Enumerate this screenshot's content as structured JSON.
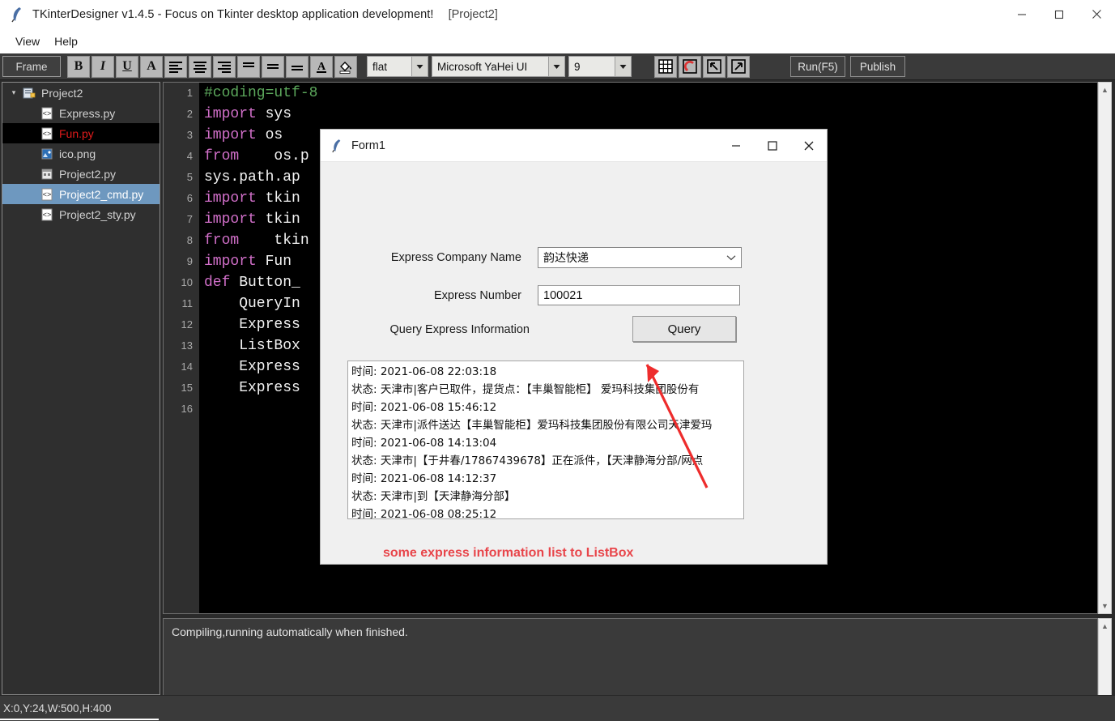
{
  "window": {
    "icon": "feather-icon",
    "title": "TKinterDesigner v1.4.5 - Focus on Tkinter desktop application development!",
    "project": "[Project2]",
    "controls": {
      "minimize": "—",
      "maximize": "□",
      "close": "✕"
    }
  },
  "menu": {
    "items": [
      {
        "label": "View"
      },
      {
        "label": "Help"
      }
    ]
  },
  "toolbar": {
    "widget_label": "Frame",
    "buttons": [
      {
        "name": "bold-button",
        "glyph": "B"
      },
      {
        "name": "italic-button",
        "glyph": "I"
      },
      {
        "name": "underline-button",
        "glyph": "U"
      },
      {
        "name": "font-button",
        "glyph": "A"
      },
      {
        "name": "align-left-button",
        "glyph": "align-left-icon"
      },
      {
        "name": "align-center-button",
        "glyph": "align-center-icon"
      },
      {
        "name": "align-right-button",
        "glyph": "align-right-icon"
      },
      {
        "name": "align-justify-button",
        "glyph": "align-justify-icon"
      },
      {
        "name": "align-top-button",
        "glyph": "align-top-icon"
      },
      {
        "name": "align-middle-button",
        "glyph": "align-middle-icon"
      },
      {
        "name": "text-color-button",
        "glyph": "A"
      },
      {
        "name": "fill-color-button",
        "glyph": "paint-bucket-icon"
      }
    ],
    "relief_value": "flat",
    "font_value": "Microsoft YaHei UI",
    "size_value": "9",
    "right_buttons": [
      {
        "name": "grid-button",
        "glyph": "grid-icon"
      },
      {
        "name": "magnet-button",
        "glyph": "magnet-icon"
      },
      {
        "name": "undo-button",
        "glyph": "undo-icon"
      },
      {
        "name": "redo-button",
        "glyph": "redo-icon"
      }
    ],
    "run_label": "Run(F5)",
    "publish_label": "Publish"
  },
  "tree": {
    "root": {
      "label": "Project2",
      "icon": "project-icon",
      "expanded": true
    },
    "items": [
      {
        "label": "Express.py",
        "icon": "code-file-icon",
        "state": "normal"
      },
      {
        "label": "Fun.py",
        "icon": "code-file-icon",
        "state": "highlight-black"
      },
      {
        "label": "ico.png",
        "icon": "image-file-icon",
        "state": "normal"
      },
      {
        "label": "Project2.py",
        "icon": "form-file-icon",
        "state": "normal"
      },
      {
        "label": "Project2_cmd.py",
        "icon": "code-file-icon",
        "state": "selected"
      },
      {
        "label": "Project2_sty.py",
        "icon": "code-file-icon",
        "state": "normal"
      }
    ]
  },
  "editor": {
    "line_numbers": [
      "1",
      "2",
      "3",
      "4",
      "5",
      "6",
      "7",
      "8",
      "9",
      "10",
      "11",
      "12",
      "13",
      "14",
      "15",
      "16"
    ],
    "lines": [
      {
        "tokens": [
          {
            "t": "#coding=utf-8",
            "c": "cmt"
          }
        ]
      },
      {
        "tokens": [
          {
            "t": "import",
            "c": "kw"
          },
          {
            "t": " sys",
            "c": "id"
          }
        ]
      },
      {
        "tokens": [
          {
            "t": "import",
            "c": "kw"
          },
          {
            "t": " os",
            "c": "id"
          }
        ]
      },
      {
        "tokens": [
          {
            "t": "from",
            "c": "kw"
          },
          {
            "t": "    os.p",
            "c": "id"
          }
        ]
      },
      {
        "tokens": [
          {
            "t": "sys.path.ap",
            "c": "id"
          }
        ]
      },
      {
        "tokens": [
          {
            "t": "import",
            "c": "kw"
          },
          {
            "t": " tkin",
            "c": "id"
          }
        ]
      },
      {
        "tokens": [
          {
            "t": "import",
            "c": "kw"
          },
          {
            "t": " tkin",
            "c": "id"
          }
        ]
      },
      {
        "tokens": [
          {
            "t": "from",
            "c": "kw"
          },
          {
            "t": "    tkin",
            "c": "id"
          }
        ]
      },
      {
        "tokens": [
          {
            "t": "import",
            "c": "kw"
          },
          {
            "t": " Fun",
            "c": "id"
          }
        ]
      },
      {
        "tokens": [
          {
            "t": "def",
            "c": "kw"
          },
          {
            "t": " Button_",
            "c": "id"
          }
        ]
      },
      {
        "tokens": [
          {
            "t": "    QueryIn",
            "c": "id"
          }
        ]
      },
      {
        "tokens": [
          {
            "t": "    Express",
            "c": "id"
          }
        ]
      },
      {
        "tokens": [
          {
            "t": "    ListBox",
            "c": "id"
          }
        ]
      },
      {
        "tokens": [
          {
            "t": "    Express",
            "c": "id"
          }
        ]
      },
      {
        "tokens": [
          {
            "t": "    Express",
            "c": "id"
          }
        ]
      },
      {
        "tokens": [
          {
            "t": "",
            "c": "id"
          }
        ]
      }
    ]
  },
  "output": {
    "text": "Compiling,running automatically when finished."
  },
  "status": {
    "text": "X:0,Y:24,W:500,H:400"
  },
  "form1": {
    "icon": "feather-icon",
    "title": "Form1",
    "controls": {
      "minimize": "—",
      "maximize": "□",
      "close": "✕"
    },
    "company_label": "Express Company Name",
    "company_value": "韵达快递",
    "number_label": "Express Number",
    "number_value": "100021",
    "query_label": "Query Express Information",
    "query_button": "Query",
    "listbox_rows": [
      "时间: 2021-06-08 22:03:18",
      "状态: 天津市|客户已取件，提货点：【丰巢智能柜】 爱玛科技集团股份有",
      "时间: 2021-06-08 15:46:12",
      "状态: 天津市|派件送达【丰巢智能柜】爱玛科技集团股份有限公司天津爱玛",
      "时间: 2021-06-08 14:13:04",
      "状态: 天津市|【于井春/17867439678】正在派件，【天津静海分部/网点",
      "时间: 2021-06-08 14:12:37",
      "状态: 天津市|到【天津静海分部】",
      "时间: 2021-06-08 08:25:12"
    ],
    "note": "some express information list to ListBox",
    "annotation_arrow_color": "#ee2c2c"
  },
  "colors": {
    "window_chrome": "#ffffff",
    "toolbar_bg": "#3a3a3a",
    "tree_bg": "#2f2f2f",
    "editor_bg": "#000000",
    "gutter_bg": "#2f2f2f",
    "selection_blue": "#6e98bf",
    "keyword": "#d16fc9",
    "comment": "#5ca85c",
    "note_red": "#e8454a",
    "file_red": "#e01b1b"
  }
}
